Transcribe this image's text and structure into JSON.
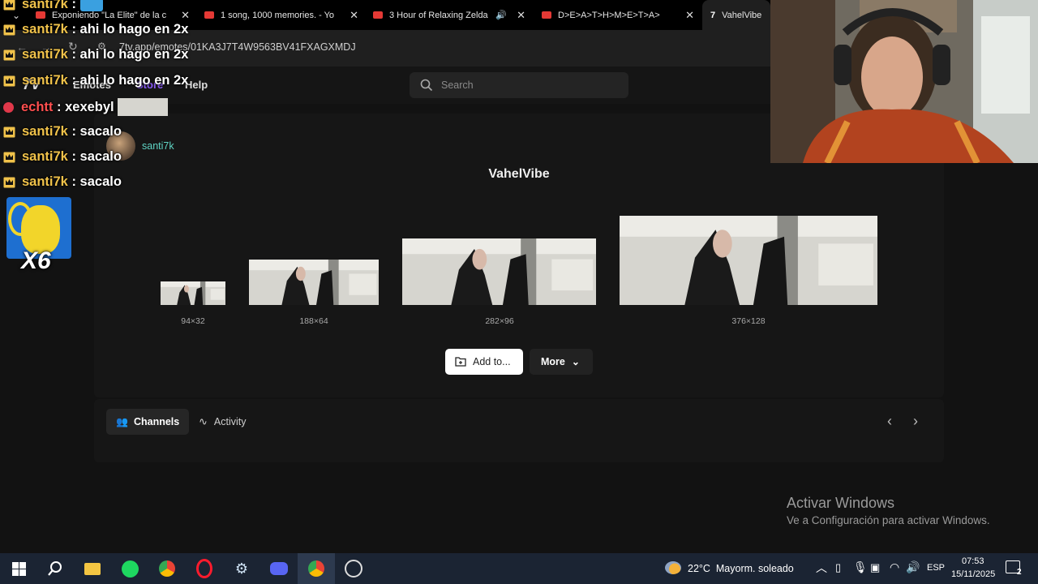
{
  "browser": {
    "tabs": [
      {
        "label": "Exponiendo \"La Elite\" de la c",
        "kind": "youtube"
      },
      {
        "label": "1 song, 1000 memories. - Yo",
        "kind": "youtube"
      },
      {
        "label": "3 Hour of Relaxing Zelda",
        "kind": "youtube"
      },
      {
        "label": "D>E>A>T>H>M>E>T>A>",
        "kind": "youtube"
      },
      {
        "label": "VahelVibe",
        "kind": "7tv",
        "active": true
      }
    ],
    "url": "7tv.app/emotes/01KA3J7T4W9563BV41FXAGXMDJ"
  },
  "site": {
    "nav": {
      "emotes": "Emotes",
      "store": "Store",
      "help": "Help"
    },
    "search_placeholder": "Search",
    "uploader": "santi7k",
    "emote_name": "VahelVibe",
    "sizes": [
      "94×32",
      "188×64",
      "282×96",
      "376×128"
    ],
    "add_button": "Add to...",
    "more_button": "More",
    "tabs": {
      "channels": "Channels",
      "activity": "Activity"
    }
  },
  "chat": [
    {
      "user": "santi7k",
      "message": "",
      "icon": "crown"
    },
    {
      "user": "santi7k",
      "message": "ahi lo hago en 2x",
      "icon": "crown"
    },
    {
      "user": "santi7k",
      "message": "ahi lo hago en 2x",
      "icon": "crown"
    },
    {
      "user": "santi7k",
      "message": "ahi lo hago en 2x",
      "icon": "crown"
    },
    {
      "user": "echtt",
      "message": "xexebyl",
      "icon": "badge"
    },
    {
      "user": "santi7k",
      "message": "sacalo",
      "icon": "crown"
    },
    {
      "user": "santi7k",
      "message": "sacalo",
      "icon": "crown"
    },
    {
      "user": "santi7k",
      "message": "sacalo",
      "icon": "crown"
    }
  ],
  "chat_sep": " : ",
  "emote_multiplier": "X6",
  "watermark": {
    "title": "Activar Windows",
    "subtitle": "Ve a Configuración para activar Windows."
  },
  "taskbar": {
    "weather": "22°C  Mayorm. soleado",
    "lang": "ESP",
    "time": "07:53",
    "date": "15/11/2025",
    "notifications": "2"
  },
  "colors": {
    "accent_purple": "#8a5cf6",
    "chat_name": "#f0c24a",
    "chat_name_red": "#ff4f4f",
    "taskbar": "#1b2433"
  }
}
